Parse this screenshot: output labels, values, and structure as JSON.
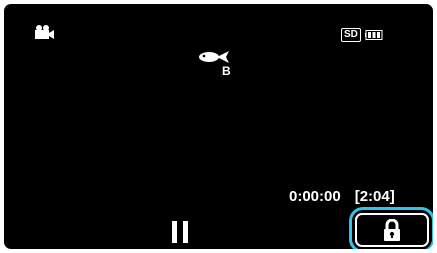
{
  "status": {
    "mode_icon": "video-camera-icon",
    "media_label": "SD",
    "battery_icon": "battery-full-icon"
  },
  "scene_mode": {
    "icon": "fish-icon",
    "label": "B"
  },
  "playback": {
    "elapsed": "0:00:00",
    "total": "[2:04]",
    "pause_icon": "pause-icon"
  },
  "lock": {
    "icon": "lock-icon",
    "highlight_color": "#36c1e8"
  },
  "colors": {
    "background": "#000000",
    "foreground": "#ffffff",
    "accent": "#36c1e8"
  }
}
